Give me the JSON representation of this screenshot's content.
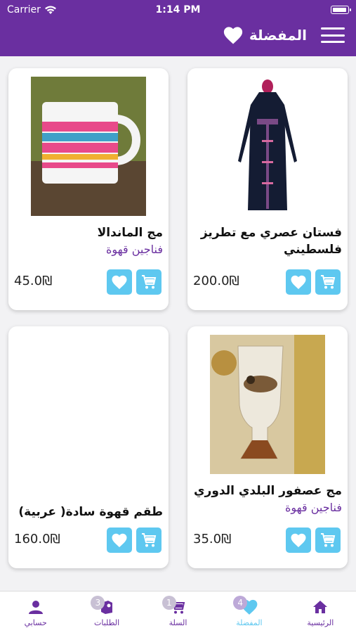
{
  "status_bar": {
    "carrier": "Carrier",
    "time": "1:14 PM"
  },
  "header": {
    "title": "المفضلة"
  },
  "products": [
    {
      "name": "فستان  عصري مع تطريز فلسطيني",
      "category": "",
      "price": "200.0₪"
    },
    {
      "name": "مج الماندالا",
      "category": "فناجين قهوة",
      "price": "45.0₪"
    },
    {
      "name": "مج عصفور البلدي الدوري",
      "category": "فناجين قهوة",
      "price": "35.0₪"
    },
    {
      "name": "طقم قهوة سادة( عربية)",
      "category": "",
      "price": "160.0₪"
    }
  ],
  "tabs": [
    {
      "label": "الرئيسية",
      "icon": "home-icon",
      "badge": ""
    },
    {
      "label": "المفضلة",
      "icon": "heart-icon",
      "badge": "4",
      "active": true
    },
    {
      "label": "السلة",
      "icon": "cart-icon",
      "badge": "1"
    },
    {
      "label": "الطلبات",
      "icon": "orders-icon",
      "badge": "3"
    },
    {
      "label": "حسابي",
      "icon": "person-icon",
      "badge": ""
    }
  ],
  "colors": {
    "primary": "#6a2fa0",
    "accent": "#5ec8f0"
  }
}
